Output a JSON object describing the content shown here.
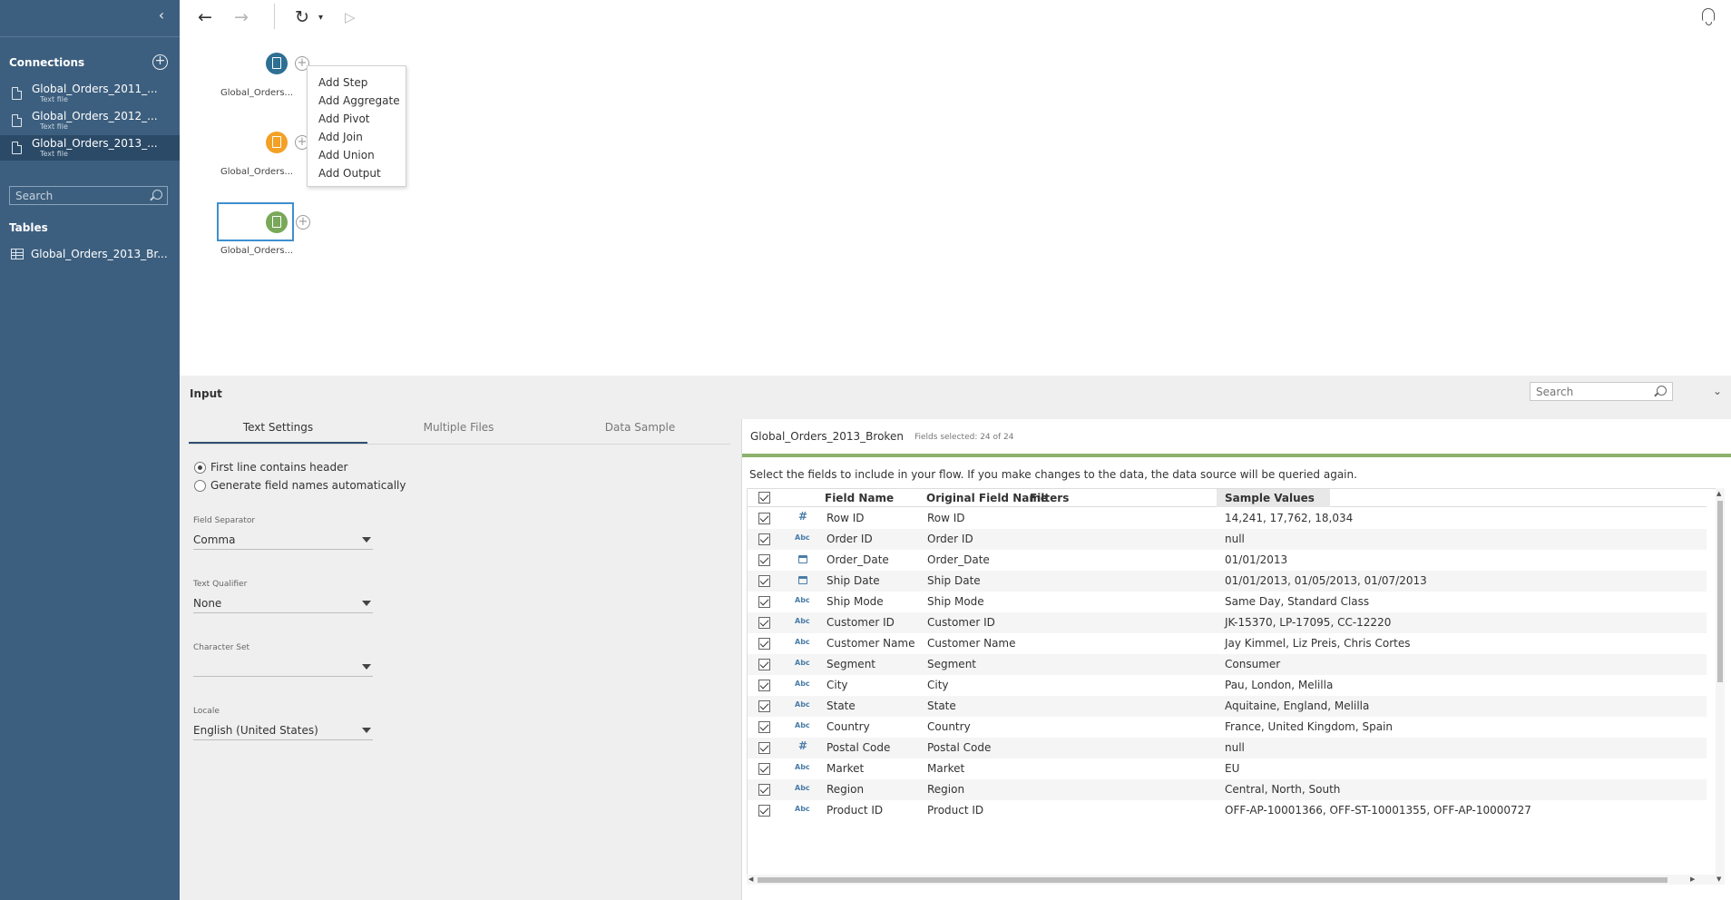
{
  "sidebar": {
    "collapse_glyph": "‹",
    "connections_title": "Connections",
    "connections": [
      {
        "name": "Global_Orders_2011_...",
        "type": "Text file"
      },
      {
        "name": "Global_Orders_2012_...",
        "type": "Text file"
      },
      {
        "name": "Global_Orders_2013_...",
        "type": "Text file"
      }
    ],
    "search_placeholder": "Search",
    "tables_title": "Tables",
    "tables": [
      {
        "name": "Global_Orders_2013_Br..."
      }
    ]
  },
  "toolbar": {
    "back_glyph": "←",
    "forward_glyph": "→",
    "refresh_glyph": "↻",
    "refresh_caret": "▾",
    "run_glyph": "▷"
  },
  "flow": {
    "colors": {
      "node1": "#2e6f94",
      "node2": "#f2a126",
      "node3": "#7aa85a"
    },
    "nodes": [
      {
        "label": "Global_Orders..."
      },
      {
        "label": "Global_Orders..."
      },
      {
        "label": "Global_Orders..."
      }
    ],
    "plus_glyph": "+",
    "context_menu": [
      "Add Step",
      "Add Aggregate",
      "Add Pivot",
      "Add Join",
      "Add Union",
      "Add Output"
    ]
  },
  "input_panel": {
    "title": "Input",
    "search_placeholder": "Search",
    "collapse_glyph": "⌄",
    "tabs": [
      "Text Settings",
      "Multiple Files",
      "Data Sample"
    ],
    "header_option_1": "First line contains header",
    "header_option_2": "Generate field names automatically",
    "field_separator_label": "Field Separator",
    "field_separator_value": "Comma",
    "text_qualifier_label": "Text Qualifier",
    "text_qualifier_value": "None",
    "character_set_label": "Character Set",
    "character_set_value": "",
    "locale_label": "Locale",
    "locale_value": "English (United States)"
  },
  "fields": {
    "datasource_name": "Global_Orders_2013_Broken",
    "fields_selected": "Fields selected: 24 of 24",
    "instruction": "Select the fields to include in your flow. If you make changes to the data, the data source will be queried again.",
    "headers": {
      "field_name": "Field Name",
      "original_field_name": "Original Field Name",
      "filters": "Filters",
      "sample_values": "Sample Values"
    },
    "rows": [
      {
        "type": "#",
        "field": "Row ID",
        "original": "Row ID",
        "sample": "14,241, 17,762, 18,034"
      },
      {
        "type": "Abc",
        "field": "Order ID",
        "original": "Order ID",
        "sample": "null"
      },
      {
        "type": "date",
        "field": "Order_Date",
        "original": "Order_Date",
        "sample": "01/01/2013"
      },
      {
        "type": "date",
        "field": "Ship Date",
        "original": "Ship Date",
        "sample": "01/01/2013, 01/05/2013, 01/07/2013"
      },
      {
        "type": "Abc",
        "field": "Ship Mode",
        "original": "Ship Mode",
        "sample": "Same Day, Standard Class"
      },
      {
        "type": "Abc",
        "field": "Customer ID",
        "original": "Customer ID",
        "sample": "JK-15370, LP-17095, CC-12220"
      },
      {
        "type": "Abc",
        "field": "Customer Name",
        "original": "Customer Name",
        "sample": "Jay Kimmel, Liz Preis, Chris Cortes"
      },
      {
        "type": "Abc",
        "field": "Segment",
        "original": "Segment",
        "sample": "Consumer"
      },
      {
        "type": "Abc",
        "field": "City",
        "original": "City",
        "sample": "Pau, London, Melilla"
      },
      {
        "type": "Abc",
        "field": "State",
        "original": "State",
        "sample": "Aquitaine, England, Melilla"
      },
      {
        "type": "Abc",
        "field": "Country",
        "original": "Country",
        "sample": "France, United Kingdom, Spain"
      },
      {
        "type": "#",
        "field": "Postal Code",
        "original": "Postal Code",
        "sample": "null"
      },
      {
        "type": "Abc",
        "field": "Market",
        "original": "Market",
        "sample": "EU"
      },
      {
        "type": "Abc",
        "field": "Region",
        "original": "Region",
        "sample": "Central, North, South"
      },
      {
        "type": "Abc",
        "field": "Product ID",
        "original": "Product ID",
        "sample": "OFF-AP-10001366, OFF-ST-10001355, OFF-AP-10000727"
      }
    ]
  }
}
